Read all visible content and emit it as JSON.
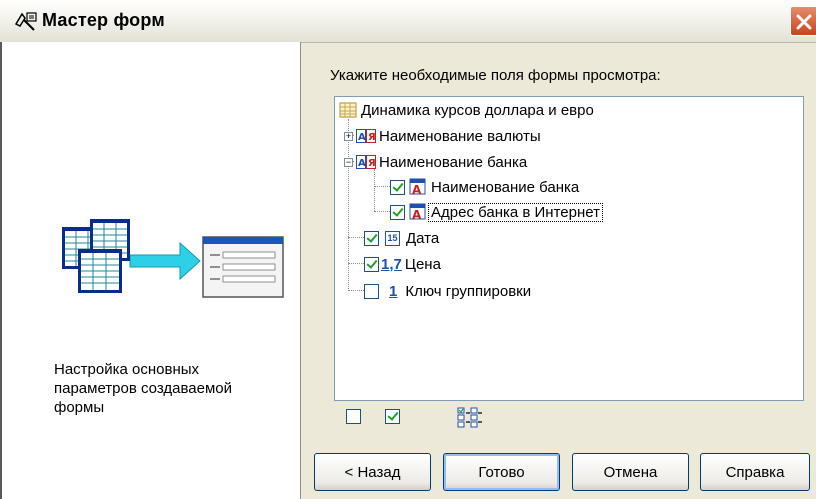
{
  "window": {
    "title": "Мастер форм",
    "title_icon": "form-wizard-icon",
    "close_icon": "close-icon"
  },
  "left_panel": {
    "illustration": "tables-to-form-illustration",
    "description": "Настройка основных параметров создаваемой формы"
  },
  "fields": {
    "prompt": "Укажите необходимые поля формы просмотра:",
    "tree": {
      "root": {
        "label": "Динамика курсов доллара и евро",
        "icon": "table-icon"
      },
      "items": [
        {
          "label": "Наименование валюты",
          "icon": "string-field-icon",
          "expander": "+",
          "checkbox": null
        },
        {
          "label": "Наименование банка",
          "icon": "string-field-icon",
          "expander": "−",
          "checkbox": null
        },
        {
          "label": "Наименование банка",
          "icon": "text-field-icon",
          "checked": true
        },
        {
          "label": "Адрес банка в Интернет",
          "icon": "text-field-icon",
          "checked": true,
          "selected": true
        },
        {
          "label": "Дата",
          "icon": "date-field-icon",
          "icon_text": "15",
          "checked": true
        },
        {
          "label": "Цена",
          "icon": "decimal-field-icon",
          "icon_text": "1,7",
          "checked": true
        },
        {
          "label": "Ключ группировки",
          "icon": "integer-field-icon",
          "icon_text": "1",
          "checked": false
        }
      ]
    }
  },
  "toolbar": {
    "uncheck_all": "uncheck-all-icon",
    "check_all": "check-all-icon",
    "tree_options": "tree-options-icon"
  },
  "buttons": {
    "back": "< Назад",
    "finish": "Готово",
    "cancel": "Отмена",
    "help": "Справка"
  },
  "colors": {
    "accent": "#316ac5",
    "close": "#c6461f",
    "check": "#21a121",
    "field_red": "#c81e1e",
    "field_blue": "#1f4fb0"
  }
}
